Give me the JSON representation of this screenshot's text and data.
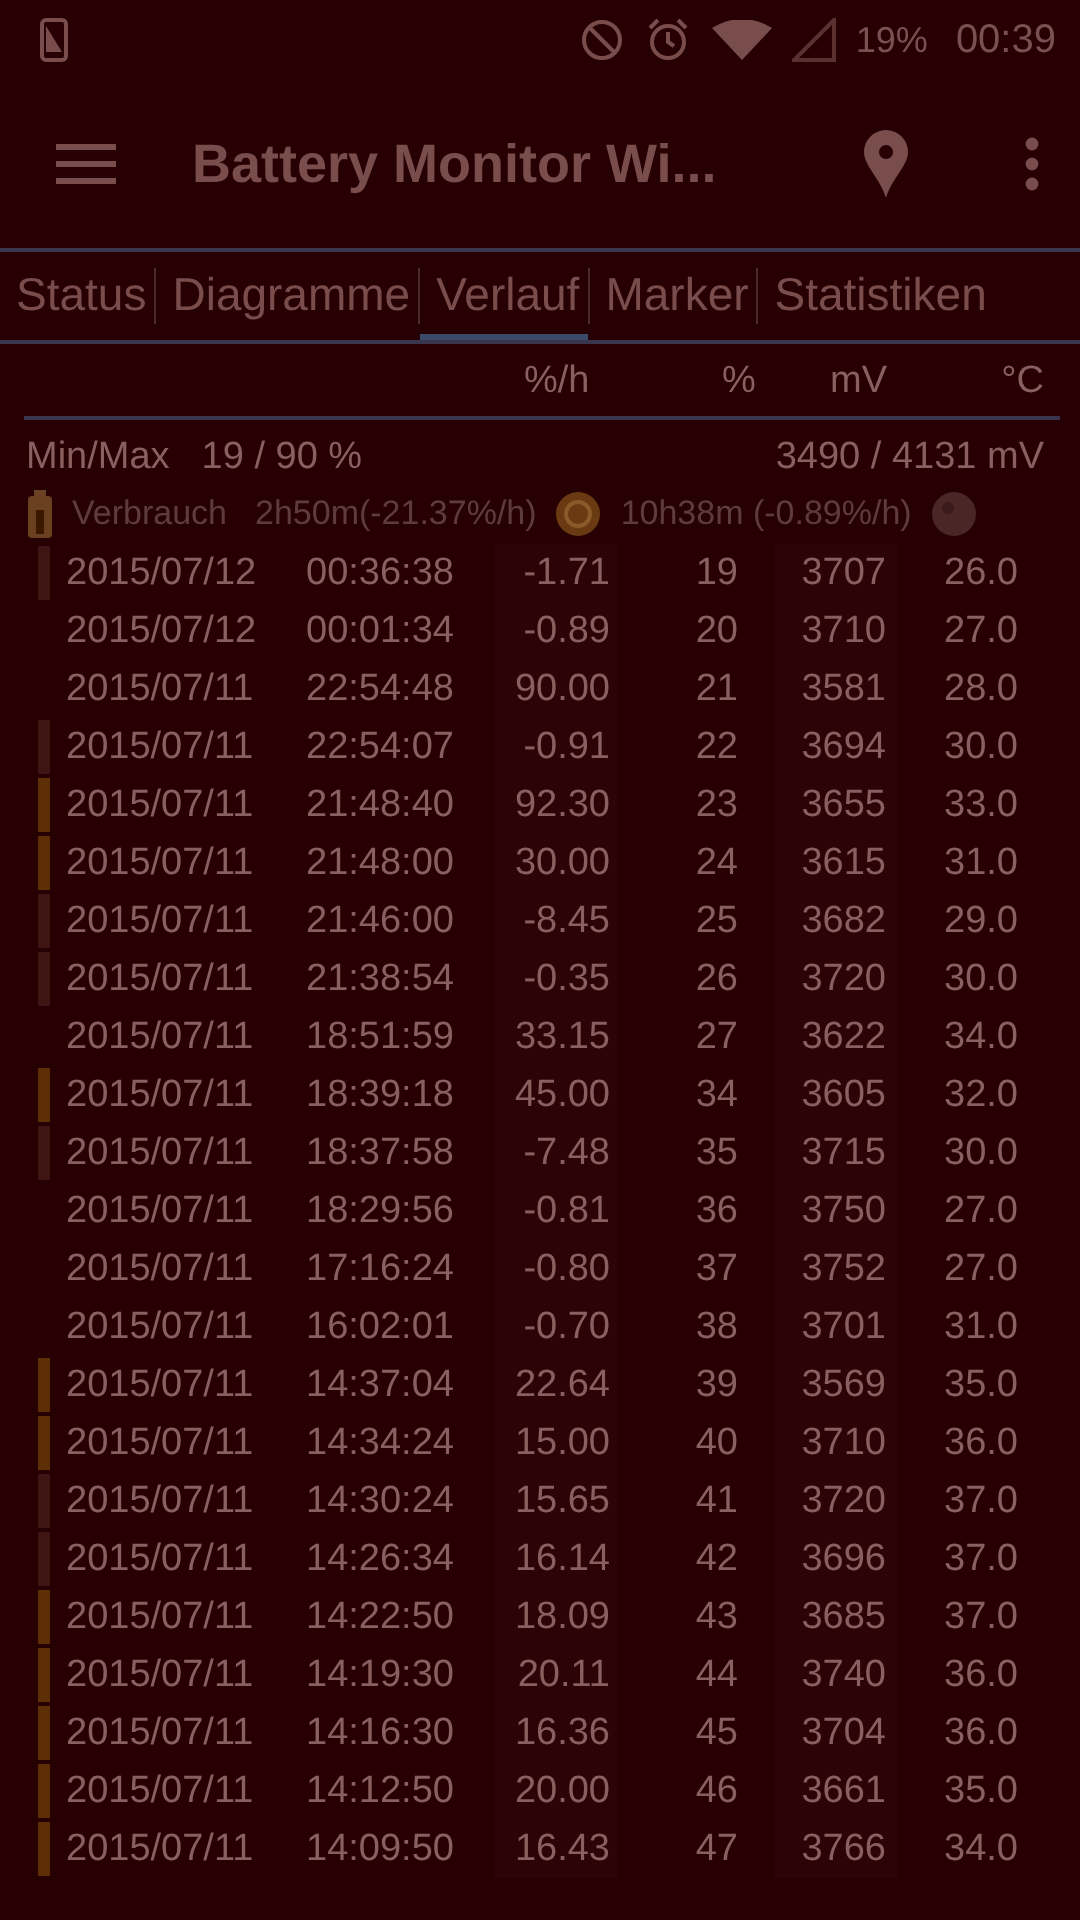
{
  "status_bar": {
    "battery": "19%",
    "time": "00:39"
  },
  "app_bar": {
    "title": "Battery Monitor Wi..."
  },
  "tabs": [
    {
      "label": "Status",
      "selected": false
    },
    {
      "label": "Diagramme",
      "selected": false
    },
    {
      "label": "Verlauf",
      "selected": true
    },
    {
      "label": "Marker",
      "selected": false
    },
    {
      "label": "Statistiken",
      "selected": false
    }
  ],
  "table": {
    "columns": [
      "%/h",
      "%",
      "mV",
      "°C"
    ],
    "min_max": {
      "label": "Min/Max",
      "percent": "19 / 90 %",
      "voltage": "3490 / 4131 mV"
    },
    "legend": {
      "label": "Verbrauch",
      "screen_on": "2h50m(-21.37%/h)",
      "screen_off": "10h38m (-0.89%/h)"
    },
    "rows": [
      {
        "date": "2015/07/12",
        "time": "00:36:38",
        "rate": "-1.71",
        "percent": "19",
        "mv": "3707",
        "temp": "26.0",
        "color": "#3e1512"
      },
      {
        "date": "2015/07/12",
        "time": "00:01:34",
        "rate": "-0.89",
        "percent": "20",
        "mv": "3710",
        "temp": "27.0"
      },
      {
        "date": "2015/07/11",
        "time": "22:54:48",
        "rate": "90.00",
        "percent": "21",
        "mv": "3581",
        "temp": "28.0"
      },
      {
        "date": "2015/07/11",
        "time": "22:54:07",
        "rate": "-0.91",
        "percent": "22",
        "mv": "3694",
        "temp": "30.0",
        "color": "#3e1512"
      },
      {
        "date": "2015/07/11",
        "time": "21:48:40",
        "rate": "92.30",
        "percent": "23",
        "mv": "3655",
        "temp": "33.0",
        "color": "#5e2e06"
      },
      {
        "date": "2015/07/11",
        "time": "21:48:00",
        "rate": "30.00",
        "percent": "24",
        "mv": "3615",
        "temp": "31.0",
        "color": "#5e2e06"
      },
      {
        "date": "2015/07/11",
        "time": "21:46:00",
        "rate": "-8.45",
        "percent": "25",
        "mv": "3682",
        "temp": "29.0",
        "color": "#3e1512"
      },
      {
        "date": "2015/07/11",
        "time": "21:38:54",
        "rate": "-0.35",
        "percent": "26",
        "mv": "3720",
        "temp": "30.0",
        "color": "#3e1512"
      },
      {
        "date": "2015/07/11",
        "time": "18:51:59",
        "rate": "33.15",
        "percent": "27",
        "mv": "3622",
        "temp": "34.0"
      },
      {
        "date": "2015/07/11",
        "time": "18:39:18",
        "rate": "45.00",
        "percent": "34",
        "mv": "3605",
        "temp": "32.0",
        "color": "#5e2e06"
      },
      {
        "date": "2015/07/11",
        "time": "18:37:58",
        "rate": "-7.48",
        "percent": "35",
        "mv": "3715",
        "temp": "30.0",
        "color": "#3e1512"
      },
      {
        "date": "2015/07/11",
        "time": "18:29:56",
        "rate": "-0.81",
        "percent": "36",
        "mv": "3750",
        "temp": "27.0"
      },
      {
        "date": "2015/07/11",
        "time": "17:16:24",
        "rate": "-0.80",
        "percent": "37",
        "mv": "3752",
        "temp": "27.0"
      },
      {
        "date": "2015/07/11",
        "time": "16:02:01",
        "rate": "-0.70",
        "percent": "38",
        "mv": "3701",
        "temp": "31.0"
      },
      {
        "date": "2015/07/11",
        "time": "14:37:04",
        "rate": "22.64",
        "percent": "39",
        "mv": "3569",
        "temp": "35.0",
        "color": "#5e2e06"
      },
      {
        "date": "2015/07/11",
        "time": "14:34:24",
        "rate": "15.00",
        "percent": "40",
        "mv": "3710",
        "temp": "36.0",
        "color": "#5e2e06"
      },
      {
        "date": "2015/07/11",
        "time": "14:30:24",
        "rate": "15.65",
        "percent": "41",
        "mv": "3720",
        "temp": "37.0",
        "color": "#3e1512"
      },
      {
        "date": "2015/07/11",
        "time": "14:26:34",
        "rate": "16.14",
        "percent": "42",
        "mv": "3696",
        "temp": "37.0",
        "color": "#3e1512"
      },
      {
        "date": "2015/07/11",
        "time": "14:22:50",
        "rate": "18.09",
        "percent": "43",
        "mv": "3685",
        "temp": "37.0",
        "color": "#5e2e06"
      },
      {
        "date": "2015/07/11",
        "time": "14:19:30",
        "rate": "20.11",
        "percent": "44",
        "mv": "3740",
        "temp": "36.0",
        "color": "#5e2e06"
      },
      {
        "date": "2015/07/11",
        "time": "14:16:30",
        "rate": "16.36",
        "percent": "45",
        "mv": "3704",
        "temp": "36.0",
        "color": "#5e2e06"
      },
      {
        "date": "2015/07/11",
        "time": "14:12:50",
        "rate": "20.00",
        "percent": "46",
        "mv": "3661",
        "temp": "35.0",
        "color": "#5e2e06"
      },
      {
        "date": "2015/07/11",
        "time": "14:09:50",
        "rate": "16.43",
        "percent": "47",
        "mv": "3766",
        "temp": "34.0",
        "color": "#5e2e06"
      }
    ]
  }
}
